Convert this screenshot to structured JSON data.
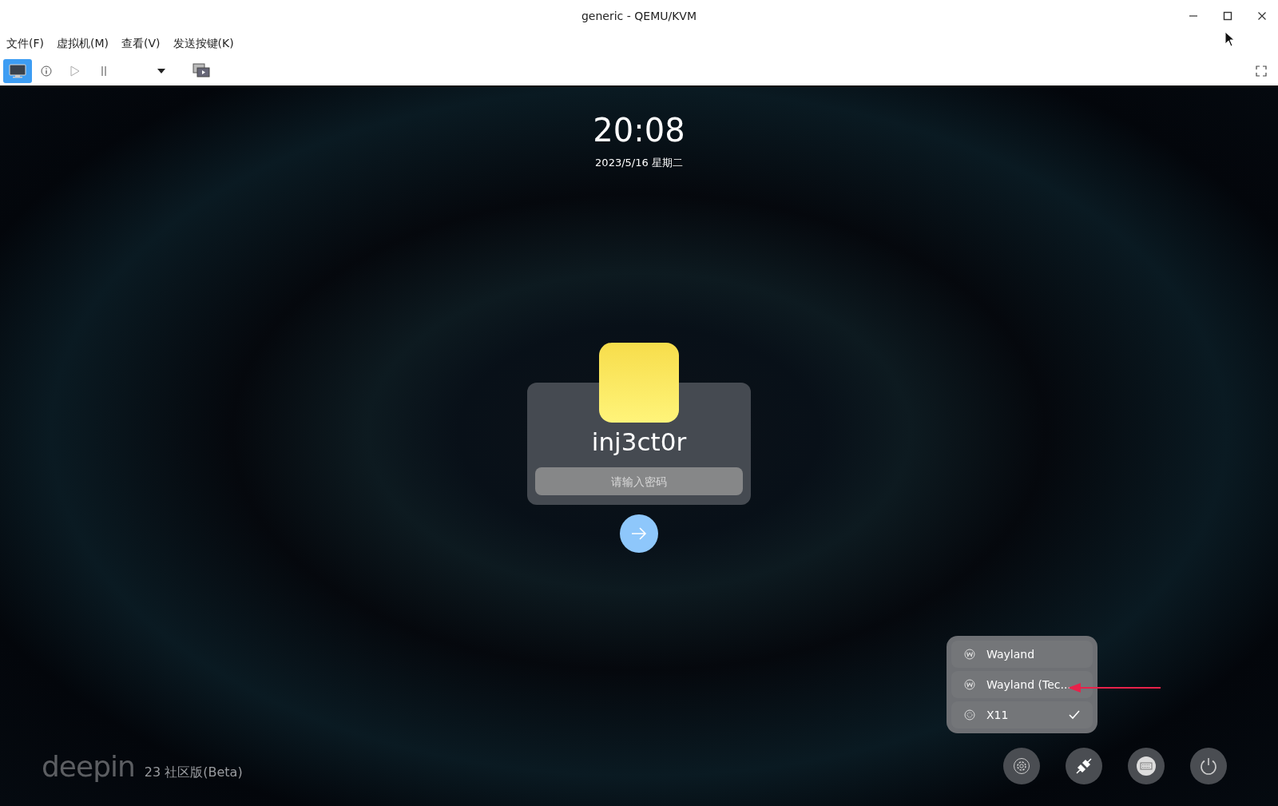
{
  "window": {
    "title": "generic - QEMU/KVM"
  },
  "menu": [
    "文件(F)",
    "虚拟机(M)",
    "查看(V)",
    "发送按键(K)"
  ],
  "toolbar": [
    {
      "kind": "console",
      "selected": true
    },
    {
      "kind": "info",
      "selected": false
    },
    {
      "kind": "run",
      "selected": false
    },
    {
      "kind": "pause",
      "selected": false
    },
    {
      "kind": "dropdown",
      "selected": false
    },
    {
      "kind": "snapshots",
      "selected": false
    }
  ],
  "lock_screen": {
    "time": "20:08",
    "date": "2023/5/16 星期二",
    "user": "inj3ct0r",
    "password": {
      "placeholder": "请输入密码"
    },
    "sessions": [
      {
        "label": "Wayland",
        "kind": "wayland",
        "selected": false
      },
      {
        "label": "Wayland (Tec...",
        "kind": "wayland",
        "selected": false
      },
      {
        "label": "X11",
        "kind": "x11",
        "selected": true
      }
    ],
    "logo": "deepin",
    "edition": "23 社区版(Beta)",
    "buttons": [
      {
        "kind": "settings"
      },
      {
        "kind": "session"
      },
      {
        "kind": "keyboard"
      },
      {
        "kind": "power"
      }
    ]
  }
}
